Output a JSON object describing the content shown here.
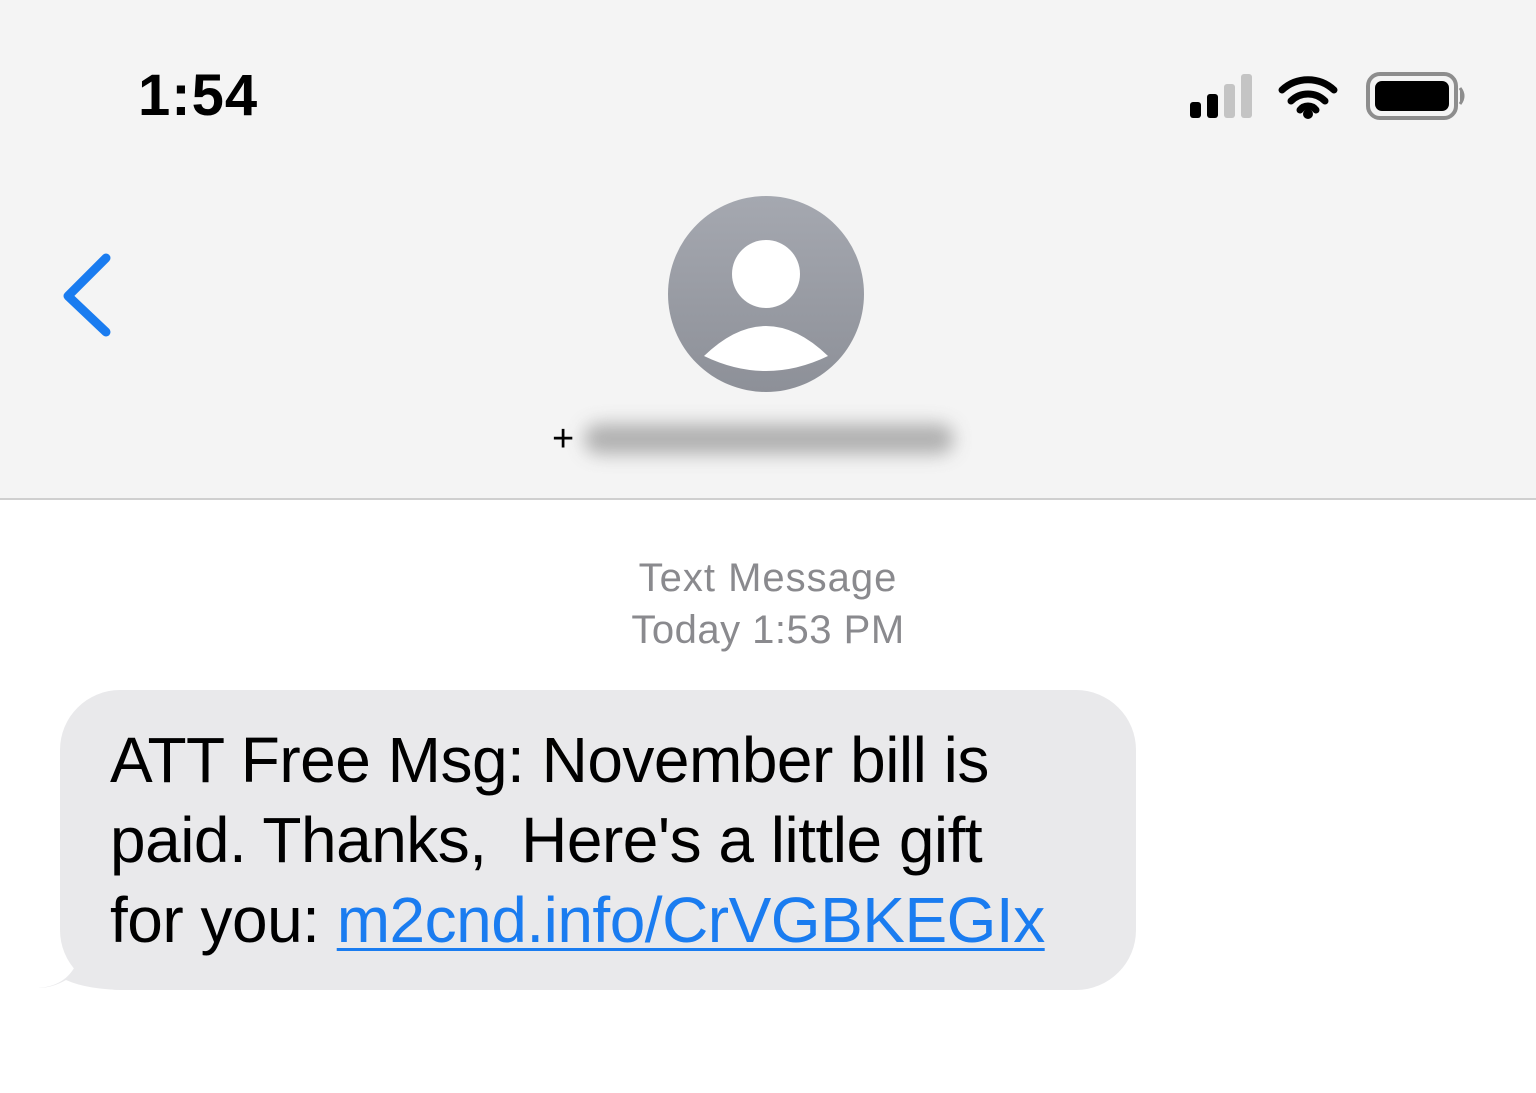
{
  "status_bar": {
    "time": "1:54",
    "icons": [
      "cellular-signal-icon",
      "wifi-icon",
      "battery-icon"
    ]
  },
  "nav": {
    "back_icon": "chevron-left-icon",
    "avatar_icon": "person-silhouette-icon",
    "contact_prefix": "+",
    "contact_number_redacted": true
  },
  "thread": {
    "service_label": "Text Message",
    "timestamp": "Today 1:53 PM"
  },
  "message": {
    "line1": "ATT Free Msg: November bill is",
    "line2": "paid. Thanks,  Here's a little gift",
    "line3_prefix": "for you: ",
    "link_text": "m2cnd.info/CrVGBKEGIx"
  },
  "colors": {
    "accent": "#1a7cf0",
    "header_bg": "#f4f4f4",
    "bubble_bg": "#e9e9eb",
    "meta_text": "#8a8a8e",
    "avatar_bg": "#9a9ca4"
  }
}
